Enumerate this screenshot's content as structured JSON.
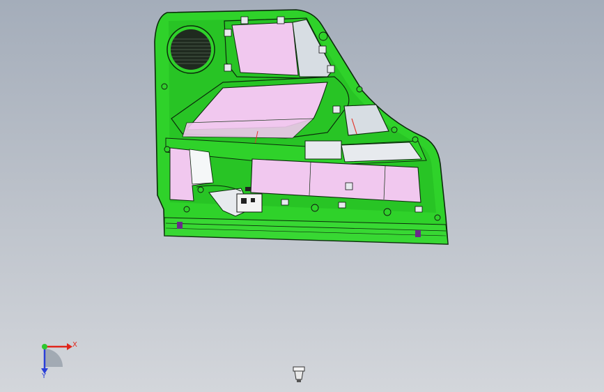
{
  "scene": {
    "background_top": "#a4adba",
    "background_bottom": "#d3d6db",
    "part_color": "#2fd22a",
    "part_edge_color": "#0b2a0b",
    "panel_color": "#f1c8ef",
    "highlight_color": "#e2372c"
  },
  "triad": {
    "x_label": "X",
    "y_label": "Y",
    "x_color": "#e0251b",
    "y_color": "#2ec82e",
    "z_color": "#2a3fd8"
  },
  "icons": {
    "view_triad": "coordinate-triad-icon",
    "view_compass": "view-compass-icon",
    "speaker": "speaker-grille-icon"
  }
}
